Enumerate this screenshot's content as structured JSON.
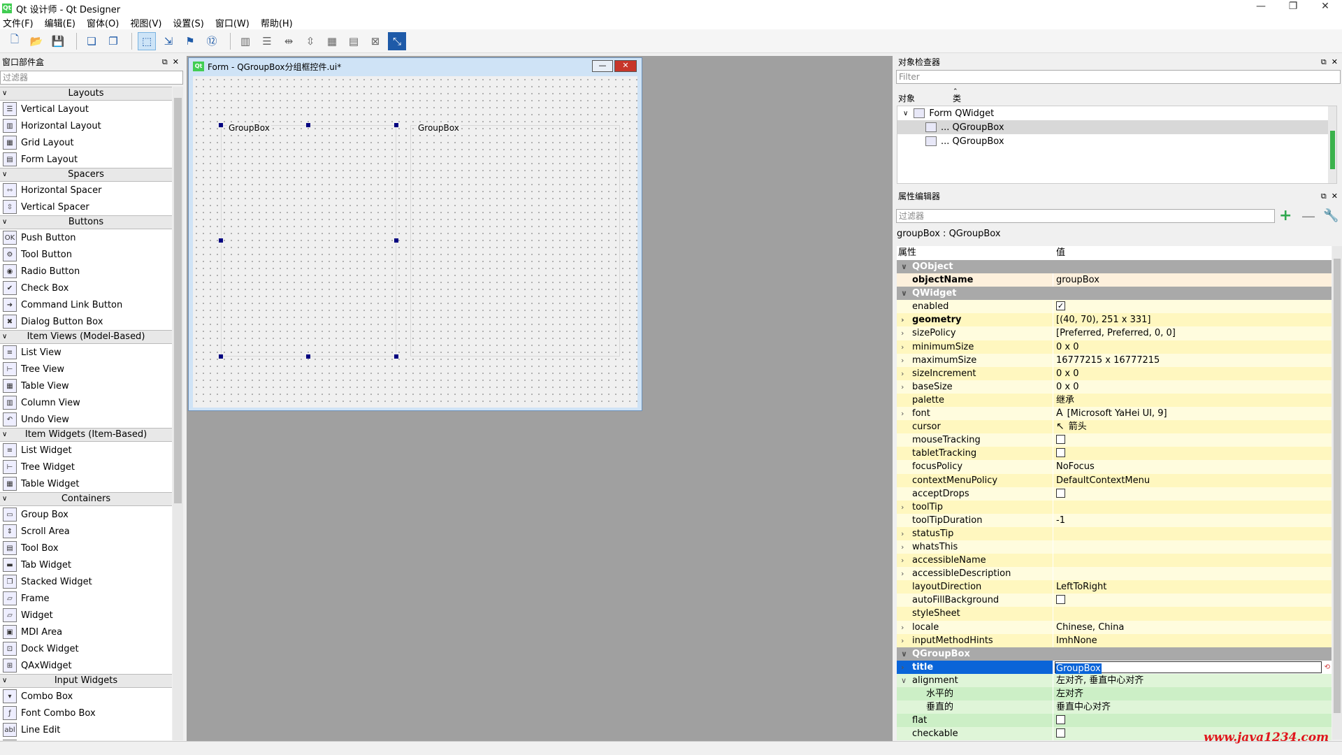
{
  "window": {
    "title": "Qt 设计师 - Qt Designer",
    "app_icon": "Qt"
  },
  "menu": [
    "文件(F)",
    "编辑(E)",
    "窗体(O)",
    "视图(V)",
    "设置(S)",
    "窗口(W)",
    "帮助(H)"
  ],
  "widget_box": {
    "title": "窗口部件盒",
    "filter_placeholder": "过滤器",
    "categories": [
      {
        "name": "Layouts",
        "items": [
          "Vertical Layout",
          "Horizontal Layout",
          "Grid Layout",
          "Form Layout"
        ]
      },
      {
        "name": "Spacers",
        "items": [
          "Horizontal Spacer",
          "Vertical Spacer"
        ]
      },
      {
        "name": "Buttons",
        "items": [
          "Push Button",
          "Tool Button",
          "Radio Button",
          "Check Box",
          "Command Link Button",
          "Dialog Button Box"
        ]
      },
      {
        "name": "Item Views (Model-Based)",
        "items": [
          "List View",
          "Tree View",
          "Table View",
          "Column View",
          "Undo View"
        ]
      },
      {
        "name": "Item Widgets (Item-Based)",
        "items": [
          "List Widget",
          "Tree Widget",
          "Table Widget"
        ]
      },
      {
        "name": "Containers",
        "items": [
          "Group Box",
          "Scroll Area",
          "Tool Box",
          "Tab Widget",
          "Stacked Widget",
          "Frame",
          "Widget",
          "MDI Area",
          "Dock Widget",
          "QAxWidget"
        ]
      },
      {
        "name": "Input Widgets",
        "items": [
          "Combo Box",
          "Font Combo Box",
          "Line Edit",
          "Text Edit"
        ]
      }
    ]
  },
  "form": {
    "title": "Form - QGroupBox分组框控件.ui*",
    "group1": "GroupBox",
    "group2": "GroupBox",
    "qt_badge": "Qt"
  },
  "object_inspector": {
    "title": "对象检查器",
    "filter_placeholder": "Filter",
    "col_object": "对象",
    "col_class": "类",
    "root": {
      "name": "Form",
      "class": "QWidget"
    },
    "children": [
      {
        "name": "...",
        "class": "QGroupBox"
      },
      {
        "name": "...",
        "class": "QGroupBox"
      }
    ]
  },
  "property_editor": {
    "title": "属性编辑器",
    "filter_placeholder": "过滤器",
    "object_label": "groupBox : QGroupBox",
    "col_prop": "属性",
    "col_value": "值",
    "rows": [
      {
        "t": "cat",
        "name": "QObject"
      },
      {
        "t": "o1",
        "name": "objectName",
        "value": "groupBox",
        "bold": true
      },
      {
        "t": "cat",
        "name": "QWidget"
      },
      {
        "t": "y1",
        "name": "enabled",
        "check": true
      },
      {
        "t": "y2",
        "name": "geometry",
        "value": "[(40, 70), 251 x 331]",
        "bold": true,
        "exp": true
      },
      {
        "t": "y1",
        "name": "sizePolicy",
        "value": "[Preferred, Preferred, 0, 0]",
        "exp": true
      },
      {
        "t": "y2",
        "name": "minimumSize",
        "value": "0 x 0",
        "exp": true
      },
      {
        "t": "y1",
        "name": "maximumSize",
        "value": "16777215 x 16777215",
        "exp": true
      },
      {
        "t": "y2",
        "name": "sizeIncrement",
        "value": "0 x 0",
        "exp": true
      },
      {
        "t": "y1",
        "name": "baseSize",
        "value": "0 x 0",
        "exp": true
      },
      {
        "t": "y2",
        "name": "palette",
        "value": "继承"
      },
      {
        "t": "y1",
        "name": "font",
        "value": "[Microsoft YaHei UI, 9]",
        "exp": true,
        "icon": "A"
      },
      {
        "t": "y2",
        "name": "cursor",
        "value": "箭头",
        "icon": "↖"
      },
      {
        "t": "y1",
        "name": "mouseTracking",
        "check": false
      },
      {
        "t": "y2",
        "name": "tabletTracking",
        "check": false
      },
      {
        "t": "y1",
        "name": "focusPolicy",
        "value": "NoFocus"
      },
      {
        "t": "y2",
        "name": "contextMenuPolicy",
        "value": "DefaultContextMenu"
      },
      {
        "t": "y1",
        "name": "acceptDrops",
        "check": false
      },
      {
        "t": "y2",
        "name": "toolTip",
        "value": "",
        "exp": true
      },
      {
        "t": "y1",
        "name": "toolTipDuration",
        "value": "-1"
      },
      {
        "t": "y2",
        "name": "statusTip",
        "value": "",
        "exp": true
      },
      {
        "t": "y1",
        "name": "whatsThis",
        "value": "",
        "exp": true
      },
      {
        "t": "y2",
        "name": "accessibleName",
        "value": "",
        "exp": true
      },
      {
        "t": "y1",
        "name": "accessibleDescription",
        "value": "",
        "exp": true
      },
      {
        "t": "y2",
        "name": "layoutDirection",
        "value": "LeftToRight"
      },
      {
        "t": "y1",
        "name": "autoFillBackground",
        "check": false
      },
      {
        "t": "y2",
        "name": "styleSheet",
        "value": ""
      },
      {
        "t": "y1",
        "name": "locale",
        "value": "Chinese, China",
        "exp": true
      },
      {
        "t": "y2",
        "name": "inputMethodHints",
        "value": "ImhNone",
        "exp": true
      },
      {
        "t": "cat",
        "name": "QGroupBox"
      },
      {
        "t": "sel",
        "name": "title",
        "value": "GroupBox",
        "exp": true
      },
      {
        "t": "g1",
        "name": "alignment",
        "value": "左对齐, 垂直中心对齐",
        "open": true
      },
      {
        "t": "g2",
        "name": "水平的",
        "value": "左对齐",
        "sub": true
      },
      {
        "t": "g1",
        "name": "垂直的",
        "value": "垂直中心对齐",
        "sub": true
      },
      {
        "t": "g2",
        "name": "flat",
        "check": false
      },
      {
        "t": "g1",
        "name": "checkable",
        "check": false
      }
    ]
  },
  "watermark": "www.java1234.com"
}
